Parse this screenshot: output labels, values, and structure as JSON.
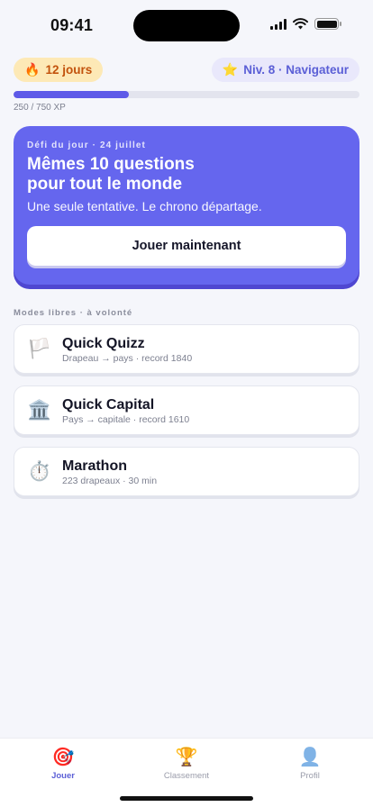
{
  "status_bar": {
    "time": "09:41"
  },
  "header": {
    "streak": {
      "emoji": "🔥",
      "label": "12 jours"
    },
    "level": {
      "emoji": "⭐",
      "label": "Niv. 8 · Navigateur"
    },
    "xp": {
      "text": "250 / 750 XP",
      "progress": 0.333
    }
  },
  "daily": {
    "kicker": "Défi du jour · 24 juillet",
    "title_line1": "Mêmes 10 questions",
    "title_line2": "pour tout le monde",
    "subtitle": "Une seule tentative. Le chrono départage.",
    "cta": "Jouer maintenant"
  },
  "modes": {
    "section_label": "Modes libres · à volonté",
    "items": [
      {
        "icon": "white-flag-icon",
        "glyph": "🏳️",
        "title": "Quick Quizz",
        "subtitle": "Drapeau → pays · record 1840"
      },
      {
        "icon": "classical-building-icon",
        "glyph": "🏛️",
        "title": "Quick Capital",
        "subtitle": "Pays → capitale · record 1610"
      },
      {
        "icon": "stopwatch-icon",
        "glyph": "⏱️",
        "title": "Marathon",
        "subtitle": "223 drapeaux · 30 min"
      }
    ]
  },
  "tabs": [
    {
      "icon": "target-icon",
      "glyph": "🎯",
      "label": "Jouer",
      "active": true
    },
    {
      "icon": "trophy-icon",
      "glyph": "🏆",
      "label": "Classement",
      "active": false
    },
    {
      "icon": "profile-icon",
      "glyph": "👤",
      "label": "Profil",
      "active": false
    }
  ],
  "colors": {
    "accent": "#6566ee",
    "streak_bg": "#fde9b6",
    "level_bg": "#e9e8fb",
    "background": "#f5f6fb"
  }
}
